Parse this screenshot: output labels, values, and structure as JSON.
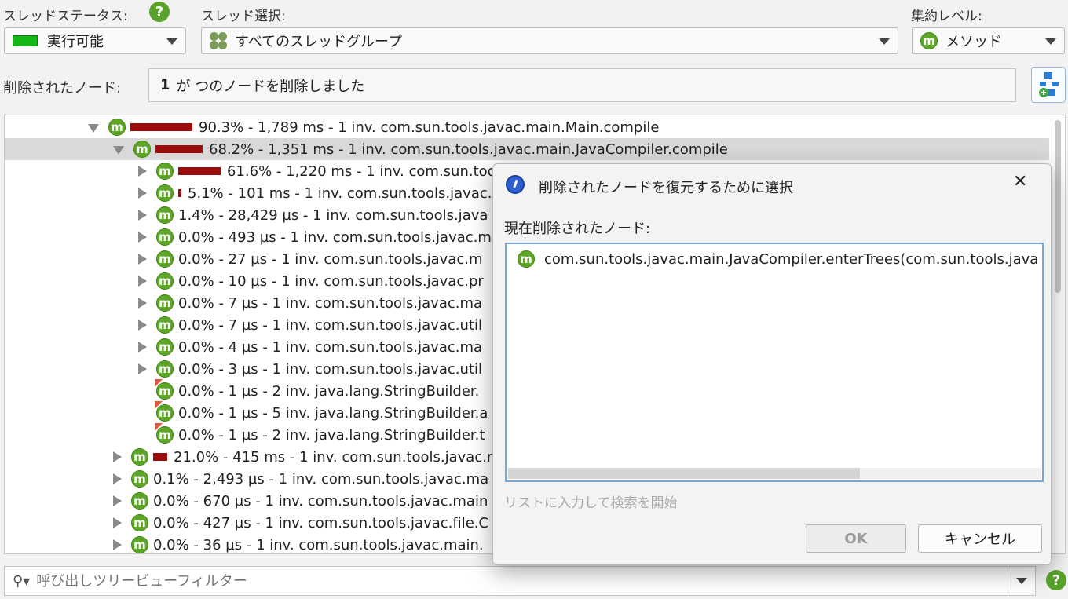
{
  "header": {
    "thread_status_label": "スレッドステータス:",
    "thread_status_value": "実行可能",
    "thread_select_label": "スレッド選択:",
    "thread_select_value": "すべてのスレッドグループ",
    "aggregation_label": "集約レベル:",
    "aggregation_value": "メソッド",
    "help_glyph": "?",
    "removed_nodes_label": "削除されたノード:",
    "removed_nodes_count": "1",
    "removed_nodes_text": "が つのノードを削除しました"
  },
  "tree": {
    "rows": [
      {
        "indent": 0,
        "expander": "open",
        "bar": 90.3,
        "text": "90.3% - 1,789 ms - 1 inv. com.sun.tools.javac.main.Main.compile",
        "flag": false,
        "selected": false
      },
      {
        "indent": 1,
        "expander": "open",
        "bar": 68.2,
        "text": "68.2% - 1,351 ms - 1 inv. com.sun.tools.javac.main.JavaCompiler.compile",
        "flag": false,
        "selected": true
      },
      {
        "indent": 2,
        "expander": "closed",
        "bar": 61.6,
        "text": "61.6% - 1,220 ms - 1 inv. com.sun.too",
        "flag": false,
        "selected": false
      },
      {
        "indent": 2,
        "expander": "closed",
        "bar": 5.1,
        "text": "5.1% - 101 ms - 1 inv. com.sun.tools.javac.",
        "flag": false,
        "selected": false
      },
      {
        "indent": 2,
        "expander": "closed",
        "bar": 0,
        "text": "1.4% - 28,429 µs - 1 inv. com.sun.tools.java",
        "flag": false,
        "selected": false
      },
      {
        "indent": 2,
        "expander": "closed",
        "bar": 0,
        "text": "0.0% - 493 µs - 1 inv. com.sun.tools.javac.m",
        "flag": false,
        "selected": false
      },
      {
        "indent": 2,
        "expander": "closed",
        "bar": 0,
        "text": "0.0% - 27 µs - 1 inv. com.sun.tools.javac.m",
        "flag": false,
        "selected": false
      },
      {
        "indent": 2,
        "expander": "closed",
        "bar": 0,
        "text": "0.0% - 10 µs - 1 inv. com.sun.tools.javac.pr",
        "flag": false,
        "selected": false
      },
      {
        "indent": 2,
        "expander": "closed",
        "bar": 0,
        "text": "0.0% - 7 µs - 1 inv. com.sun.tools.javac.ma",
        "flag": false,
        "selected": false
      },
      {
        "indent": 2,
        "expander": "closed",
        "bar": 0,
        "text": "0.0% - 7 µs - 1 inv. com.sun.tools.javac.util",
        "flag": false,
        "selected": false
      },
      {
        "indent": 2,
        "expander": "closed",
        "bar": 0,
        "text": "0.0% - 4 µs - 1 inv. com.sun.tools.javac.ma",
        "flag": false,
        "selected": false
      },
      {
        "indent": 2,
        "expander": "closed",
        "bar": 0,
        "text": "0.0% - 3 µs - 1 inv. com.sun.tools.javac.util",
        "flag": false,
        "selected": false
      },
      {
        "indent": 2,
        "expander": "none",
        "bar": 0,
        "text": "0.0% - 1 µs - 2 inv. java.lang.StringBuilder.",
        "flag": true,
        "selected": false
      },
      {
        "indent": 2,
        "expander": "none",
        "bar": 0,
        "text": "0.0% - 1 µs - 5 inv. java.lang.StringBuilder.a",
        "flag": true,
        "selected": false
      },
      {
        "indent": 2,
        "expander": "none",
        "bar": 0,
        "text": "0.0% - 1 µs - 2 inv. java.lang.StringBuilder.t",
        "flag": true,
        "selected": false
      },
      {
        "indent": 1,
        "expander": "closed",
        "bar": 21.0,
        "text": "21.0% - 415 ms - 1 inv. com.sun.tools.javac.r",
        "flag": false,
        "selected": false
      },
      {
        "indent": 1,
        "expander": "closed",
        "bar": 0,
        "text": "0.1% - 2,493 µs - 1 inv. com.sun.tools.javac.ma",
        "flag": false,
        "selected": false
      },
      {
        "indent": 1,
        "expander": "closed",
        "bar": 0,
        "text": "0.0% - 670 µs - 1 inv. com.sun.tools.javac.main",
        "flag": false,
        "selected": false
      },
      {
        "indent": 1,
        "expander": "closed",
        "bar": 0,
        "text": "0.0% - 427 µs - 1 inv. com.sun.tools.javac.file.C",
        "flag": false,
        "selected": false
      },
      {
        "indent": 1,
        "expander": "closed",
        "bar": 0,
        "text": "0.0% - 36 µs - 1 inv. com.sun.tools.javac.main.",
        "flag": false,
        "selected": false
      }
    ]
  },
  "method_glyph": "m",
  "filter": {
    "placeholder": "呼び出しツリービューフィルター"
  },
  "dialog": {
    "title": "削除されたノードを復元するために選択",
    "close_glyph": "✕",
    "list_label": "現在削除されたノード:",
    "items": [
      "com.sun.tools.javac.main.JavaCompiler.enterTrees(com.sun.tools.java"
    ],
    "search_hint": "リストに入力して検索を開始",
    "ok_label": "OK",
    "cancel_label": "キャンセル"
  },
  "colors": {
    "bar": "#9b0d0d",
    "method_icon": "#5ea626",
    "status_runnable": "#14b814"
  }
}
